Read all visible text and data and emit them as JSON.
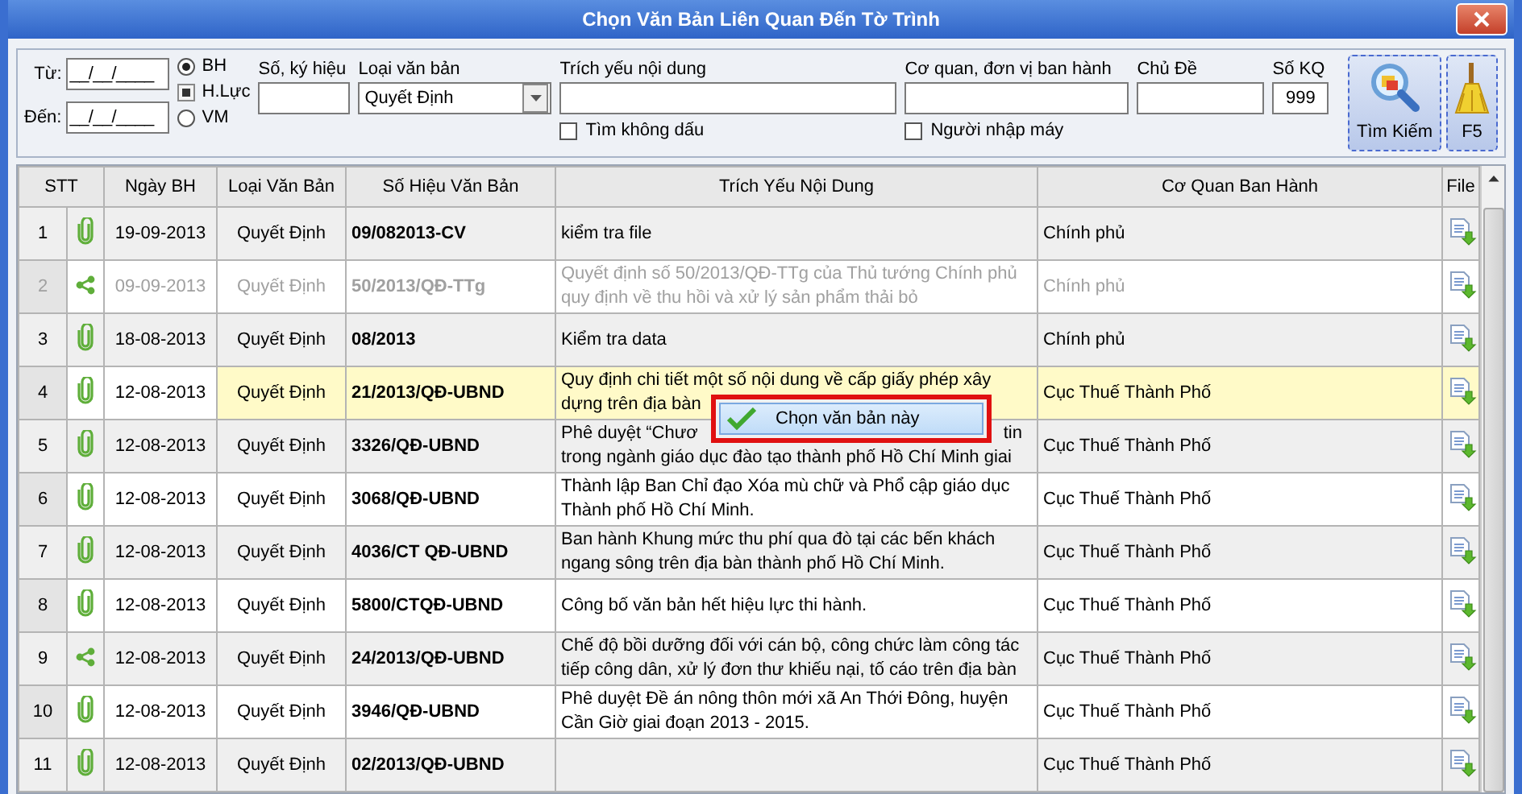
{
  "window": {
    "title": "Chọn Văn Bản Liên Quan Đến Tờ Trình"
  },
  "filters": {
    "dates": [
      {
        "label": "Từ:",
        "value": "__/__/____"
      },
      {
        "label": "Đến:",
        "value": "__/__/____"
      }
    ],
    "modes": [
      {
        "label": "BH",
        "kind": "radio",
        "selected": true
      },
      {
        "label": "H.Lực",
        "kind": "square",
        "selected": true
      },
      {
        "label": "VM",
        "kind": "radio",
        "selected": false
      }
    ],
    "fields": [
      {
        "label": "Số, ký hiệu",
        "kind": "text"
      },
      {
        "label": "Loại văn bản",
        "kind": "dropdown",
        "value": "Quyết Định"
      },
      {
        "label": "Trích yếu nội dung",
        "kind": "text",
        "checkbox": {
          "label": "Tìm không dấu",
          "checked": false
        }
      },
      {
        "label": "Cơ quan, đơn vị ban hành",
        "kind": "text",
        "checkbox": {
          "label": "Người nhập máy",
          "checked": false
        }
      },
      {
        "label": "Chủ Đề",
        "kind": "text"
      },
      {
        "label": "Số KQ",
        "kind": "text",
        "value": "999"
      }
    ],
    "buttons": [
      {
        "label": "Tìm Kiếm",
        "kind": "search"
      },
      {
        "label": "F5",
        "kind": "broom"
      }
    ]
  },
  "table": {
    "columns": [
      "STT",
      "Ngày BH",
      "Loại Văn Bản",
      "Số Hiệu Văn Bản",
      "Trích Yếu Nội Dung",
      "Cơ Quan Ban Hành",
      "File"
    ],
    "rows": [
      {
        "stt": "1",
        "kind": "attachment",
        "date": "19-09-2013",
        "type": "Quyết Định",
        "number": "09/082013-CV",
        "summary": [
          [
            "kiểm tra file"
          ]
        ],
        "agency": "Chính phủ",
        "selected": false,
        "disabled": false
      },
      {
        "stt": "2",
        "kind": "share",
        "date": "09-09-2013",
        "type": "Quyết Định",
        "number": "50/2013/QĐ-TTg",
        "summary": [
          [
            "Quyết định số 50/2013/QĐ-TTg của Thủ tướng Chính phủ"
          ],
          [
            "quy định về thu hồi và xử lý sản phẩm thải bỏ"
          ]
        ],
        "agency": "Chính phủ",
        "selected": false,
        "disabled": true
      },
      {
        "stt": "3",
        "kind": "attachment",
        "date": "18-08-2013",
        "type": "Quyết Định",
        "number": "08/2013",
        "summary": [
          [
            "Kiểm tra data"
          ]
        ],
        "agency": "Chính phủ",
        "selected": false,
        "disabled": false
      },
      {
        "stt": "4",
        "kind": "attachment",
        "date": "12-08-2013",
        "type": "Quyết Định",
        "number": "21/2013/QĐ-UBND",
        "summary": [
          [
            "Quy định chi tiết một số nội dung về cấp giấy phép xây"
          ],
          [
            "dựng trên địa bàn"
          ]
        ],
        "agency": "Cục Thuế Thành Phố",
        "selected": true,
        "disabled": false
      },
      {
        "stt": "5",
        "kind": "attachment",
        "date": "12-08-2013",
        "type": "Quyết Định",
        "number": "3326/QĐ-UBND",
        "summary": [
          [
            "Phê duyệt “Chươ",
            "tin"
          ],
          [
            "trong ngành giáo dục đào tạo thành phố Hồ Chí Minh giai"
          ]
        ],
        "agency": "Cục Thuế Thành Phố",
        "selected": false,
        "disabled": false
      },
      {
        "stt": "6",
        "kind": "attachment",
        "date": "12-08-2013",
        "type": "Quyết Định",
        "number": "3068/QĐ-UBND",
        "summary": [
          [
            "Thành lập Ban Chỉ đạo Xóa mù chữ và Phổ cập giáo dục"
          ],
          [
            "Thành phố Hồ Chí Minh."
          ]
        ],
        "agency": "Cục Thuế Thành Phố",
        "selected": false,
        "disabled": false
      },
      {
        "stt": "7",
        "kind": "attachment",
        "date": "12-08-2013",
        "type": "Quyết Định",
        "number": "4036/CT QĐ-UBND",
        "summary": [
          [
            "Ban hành Khung mức thu phí qua đò tại các bến khách"
          ],
          [
            "ngang sông trên địa bàn thành phố Hồ Chí Minh."
          ]
        ],
        "agency": "Cục Thuế Thành Phố",
        "selected": false,
        "disabled": false
      },
      {
        "stt": "8",
        "kind": "attachment",
        "date": "12-08-2013",
        "type": "Quyết Định",
        "number": "5800/CTQĐ-UBND",
        "summary": [
          [
            "Công bố văn bản hết hiệu lực thi hành."
          ]
        ],
        "agency": "Cục Thuế Thành Phố",
        "selected": false,
        "disabled": false
      },
      {
        "stt": "9",
        "kind": "share",
        "date": "12-08-2013",
        "type": "Quyết Định",
        "number": "24/2013/QĐ-UBND",
        "summary": [
          [
            "Chế độ bồi dưỡng đối với cán bộ, công chức làm công tác"
          ],
          [
            "tiếp công dân, xử lý đơn thư khiếu nại, tố cáo trên địa bàn"
          ]
        ],
        "agency": "Cục Thuế Thành Phố",
        "selected": false,
        "disabled": false
      },
      {
        "stt": "10",
        "kind": "attachment",
        "date": "12-08-2013",
        "type": "Quyết Định",
        "number": "3946/QĐ-UBND",
        "summary": [
          [
            "Phê duyệt Đề án nông thôn mới xã An Thới Đông, huyện"
          ],
          [
            "Cần Giờ giai đoạn 2013 - 2015."
          ]
        ],
        "agency": "Cục Thuế Thành Phố",
        "selected": false,
        "disabled": false
      },
      {
        "stt": "11",
        "kind": "attachment",
        "date": "12-08-2013",
        "type": "Quyết Định",
        "number": "02/2013/QĐ-UBND",
        "summary": [],
        "agency": "Cục Thuế Thành Phố",
        "selected": false,
        "disabled": false
      }
    ]
  },
  "context_menu": {
    "items": [
      {
        "label": "Chọn văn bản này",
        "selected": true
      }
    ]
  }
}
